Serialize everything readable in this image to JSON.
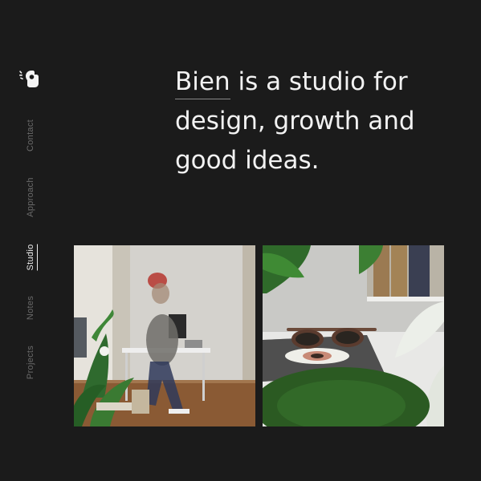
{
  "brand": {
    "logo_icon": "ok-hand-icon"
  },
  "nav": {
    "items": [
      {
        "label": "Contact",
        "active": false
      },
      {
        "label": "Approach",
        "active": false
      },
      {
        "label": "Studio",
        "active": true
      },
      {
        "label": "Notes",
        "active": false
      },
      {
        "label": "Projects",
        "active": false
      }
    ]
  },
  "hero": {
    "headline_lead": "Bien",
    "headline_rest": " is a studio for design, growth and good ideas."
  },
  "photos": [
    {
      "subject": "studio-office-photo"
    },
    {
      "subject": "sunglasses-on-book-photo"
    }
  ],
  "colors": {
    "background": "#1b1b1b",
    "text": "#f2f2f2",
    "nav_inactive": "#6a6a6a"
  }
}
